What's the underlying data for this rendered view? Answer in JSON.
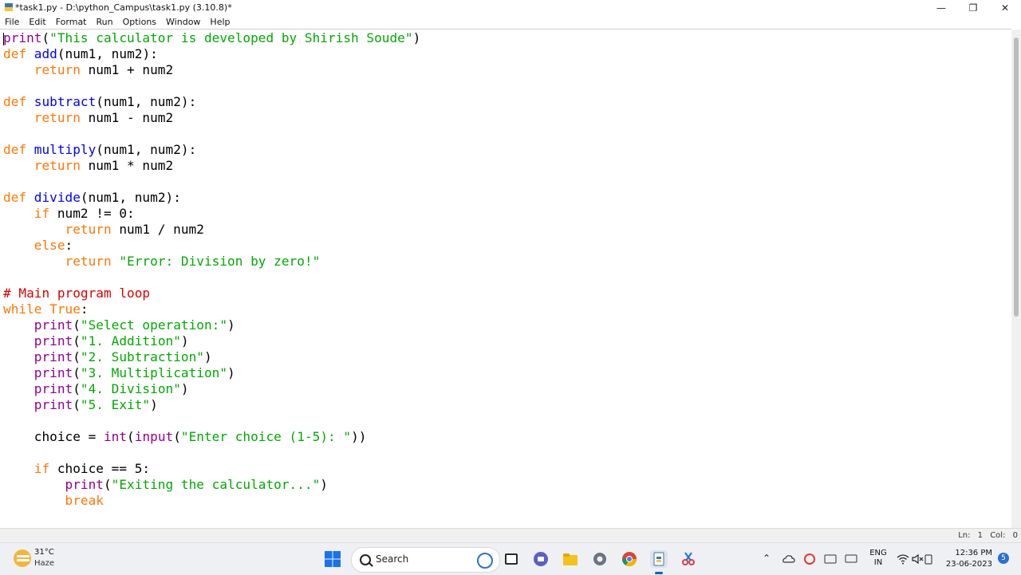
{
  "window": {
    "title": "*task1.py - D:\\python_Campus\\task1.py (3.10.8)*",
    "minimize_glyph": "—",
    "maximize_glyph": "❐",
    "close_glyph": "✕"
  },
  "menu": {
    "items": [
      "File",
      "Edit",
      "Format",
      "Run",
      "Options",
      "Window",
      "Help"
    ]
  },
  "editor": {
    "lines": [
      [
        {
          "t": "print",
          "c": "bi"
        },
        {
          "t": "(",
          "c": ""
        },
        {
          "t": "\"This calculator is developed by Shirish Soude\"",
          "c": "st"
        },
        {
          "t": ")",
          "c": ""
        }
      ],
      [
        {
          "t": "def",
          "c": "kw"
        },
        {
          "t": " ",
          "c": ""
        },
        {
          "t": "add",
          "c": "df"
        },
        {
          "t": "(num1, num2):",
          "c": ""
        }
      ],
      [
        {
          "t": "    ",
          "c": ""
        },
        {
          "t": "return",
          "c": "kw"
        },
        {
          "t": " num1 + num2",
          "c": ""
        }
      ],
      [],
      [
        {
          "t": "def",
          "c": "kw"
        },
        {
          "t": " ",
          "c": ""
        },
        {
          "t": "subtract",
          "c": "df"
        },
        {
          "t": "(num1, num2):",
          "c": ""
        }
      ],
      [
        {
          "t": "    ",
          "c": ""
        },
        {
          "t": "return",
          "c": "kw"
        },
        {
          "t": " num1 - num2",
          "c": ""
        }
      ],
      [],
      [
        {
          "t": "def",
          "c": "kw"
        },
        {
          "t": " ",
          "c": ""
        },
        {
          "t": "multiply",
          "c": "df"
        },
        {
          "t": "(num1, num2):",
          "c": ""
        }
      ],
      [
        {
          "t": "    ",
          "c": ""
        },
        {
          "t": "return",
          "c": "kw"
        },
        {
          "t": " num1 * num2",
          "c": ""
        }
      ],
      [],
      [
        {
          "t": "def",
          "c": "kw"
        },
        {
          "t": " ",
          "c": ""
        },
        {
          "t": "divide",
          "c": "df"
        },
        {
          "t": "(num1, num2):",
          "c": ""
        }
      ],
      [
        {
          "t": "    ",
          "c": ""
        },
        {
          "t": "if",
          "c": "kw"
        },
        {
          "t": " num2 != 0:",
          "c": ""
        }
      ],
      [
        {
          "t": "        ",
          "c": ""
        },
        {
          "t": "return",
          "c": "kw"
        },
        {
          "t": " num1 / num2",
          "c": ""
        }
      ],
      [
        {
          "t": "    ",
          "c": ""
        },
        {
          "t": "else",
          "c": "kw"
        },
        {
          "t": ":",
          "c": ""
        }
      ],
      [
        {
          "t": "        ",
          "c": ""
        },
        {
          "t": "return",
          "c": "kw"
        },
        {
          "t": " ",
          "c": ""
        },
        {
          "t": "\"Error: Division by zero!\"",
          "c": "st"
        }
      ],
      [],
      [
        {
          "t": "# Main program loop",
          "c": "cm"
        }
      ],
      [
        {
          "t": "while",
          "c": "kw"
        },
        {
          "t": " ",
          "c": ""
        },
        {
          "t": "True",
          "c": "kw"
        },
        {
          "t": ":",
          "c": ""
        }
      ],
      [
        {
          "t": "    ",
          "c": ""
        },
        {
          "t": "print",
          "c": "bi"
        },
        {
          "t": "(",
          "c": ""
        },
        {
          "t": "\"Select operation:\"",
          "c": "st"
        },
        {
          "t": ")",
          "c": ""
        }
      ],
      [
        {
          "t": "    ",
          "c": ""
        },
        {
          "t": "print",
          "c": "bi"
        },
        {
          "t": "(",
          "c": ""
        },
        {
          "t": "\"1. Addition\"",
          "c": "st"
        },
        {
          "t": ")",
          "c": ""
        }
      ],
      [
        {
          "t": "    ",
          "c": ""
        },
        {
          "t": "print",
          "c": "bi"
        },
        {
          "t": "(",
          "c": ""
        },
        {
          "t": "\"2. Subtraction\"",
          "c": "st"
        },
        {
          "t": ")",
          "c": ""
        }
      ],
      [
        {
          "t": "    ",
          "c": ""
        },
        {
          "t": "print",
          "c": "bi"
        },
        {
          "t": "(",
          "c": ""
        },
        {
          "t": "\"3. Multiplication\"",
          "c": "st"
        },
        {
          "t": ")",
          "c": ""
        }
      ],
      [
        {
          "t": "    ",
          "c": ""
        },
        {
          "t": "print",
          "c": "bi"
        },
        {
          "t": "(",
          "c": ""
        },
        {
          "t": "\"4. Division\"",
          "c": "st"
        },
        {
          "t": ")",
          "c": ""
        }
      ],
      [
        {
          "t": "    ",
          "c": ""
        },
        {
          "t": "print",
          "c": "bi"
        },
        {
          "t": "(",
          "c": ""
        },
        {
          "t": "\"5. Exit\"",
          "c": "st"
        },
        {
          "t": ")",
          "c": ""
        }
      ],
      [],
      [
        {
          "t": "    choice = ",
          "c": ""
        },
        {
          "t": "int",
          "c": "bi"
        },
        {
          "t": "(",
          "c": ""
        },
        {
          "t": "input",
          "c": "bi"
        },
        {
          "t": "(",
          "c": ""
        },
        {
          "t": "\"Enter choice (1-5): \"",
          "c": "st"
        },
        {
          "t": "))",
          "c": ""
        }
      ],
      [],
      [
        {
          "t": "    ",
          "c": ""
        },
        {
          "t": "if",
          "c": "kw"
        },
        {
          "t": " choice == 5:",
          "c": ""
        }
      ],
      [
        {
          "t": "        ",
          "c": ""
        },
        {
          "t": "print",
          "c": "bi"
        },
        {
          "t": "(",
          "c": ""
        },
        {
          "t": "\"Exiting the calculator...\"",
          "c": "st"
        },
        {
          "t": ")",
          "c": ""
        }
      ],
      [
        {
          "t": "        ",
          "c": ""
        },
        {
          "t": "break",
          "c": "kw"
        }
      ]
    ]
  },
  "status": {
    "position": "Ln: 1  Col: 0"
  },
  "taskbar": {
    "temperature": "31°C",
    "condition": "Haze",
    "search_label": "Search",
    "lang_top": "ENG",
    "lang_bottom": "IN",
    "time": "12:36 PM",
    "date": "23-06-2023",
    "notification_count": "5"
  },
  "colors": {
    "keyword": "#ff7700",
    "builtin": "#900090",
    "string": "#00aa00",
    "comment": "#dd0000",
    "definition": "#0000ff"
  }
}
